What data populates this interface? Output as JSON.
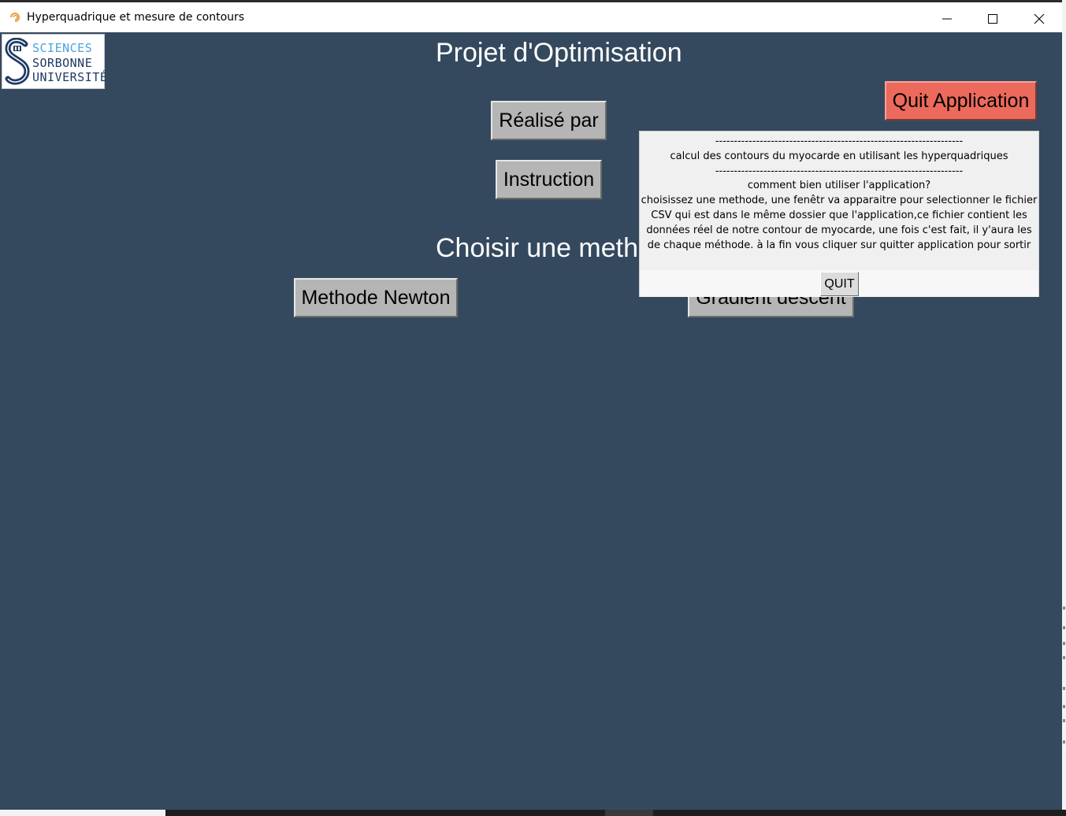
{
  "window": {
    "title": "Hyperquadrique et mesure de contours",
    "minimize_icon": "minimize-icon",
    "maximize_icon": "maximize-icon",
    "close_icon": "close-icon"
  },
  "logo": {
    "line1": "SCIENCES",
    "line2": "SORBONNE",
    "line3": "UNIVERSITÉ"
  },
  "main": {
    "title": "Projet d'Optimisation",
    "realise_label": "Réalisé par",
    "instruction_label": "Instruction",
    "choose_label": "Choisir une methode",
    "newton_label": "Methode Newton",
    "gradient_label": "Gradient descent",
    "quit_app_label": "Quit Application"
  },
  "popup": {
    "lines": [
      "-------------------------------------------------------------------",
      "calcul des contours du myocarde en utilisant les hyperquadriques",
      "-------------------------------------------------------------------",
      "comment bien utiliser l'application?",
      "choisissez une methode, une fenêtr va apparaitre pour selectionner le fichier",
      "CSV qui est dans le même dossier que l'application,ce fichier contient les",
      "données réel de notre contour de myocarde, une fois c'est fait, il y'aura les",
      "de chaque méthode. à la fin vous cliquer sur quitter application pour sortir"
    ],
    "quit_label": "QUIT"
  },
  "colors": {
    "background": "#34495e",
    "quit_app": "#ec6a5c",
    "button": "#b5b5b5"
  }
}
